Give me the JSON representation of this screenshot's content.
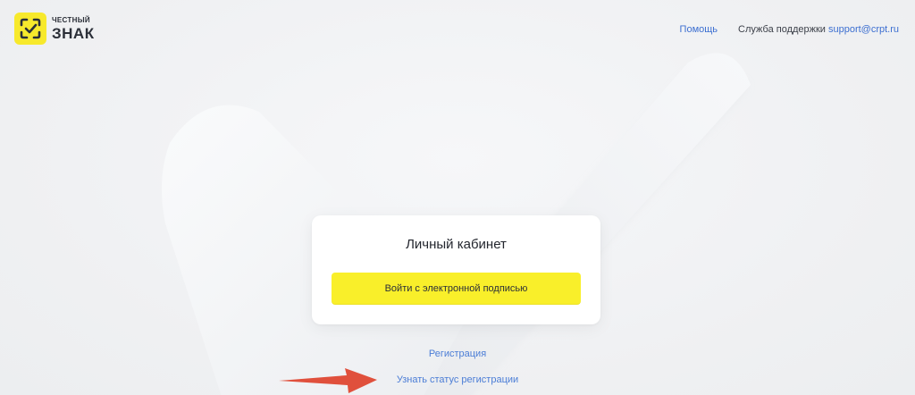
{
  "header": {
    "logo": {
      "line1": "ЧЕСТНЫЙ",
      "line2": "ЗНАК",
      "icon": "check-frame-icon"
    },
    "nav": {
      "help_label": "Помощь",
      "support_label": "Служба поддержки",
      "support_email": "support@crpt.ru"
    }
  },
  "login_card": {
    "title": "Личный кабинет",
    "sign_button_label": "Войти с электронной подписью"
  },
  "links": {
    "register": "Регистрация",
    "registration_status": "Узнать статус регистрации"
  },
  "annotation": {
    "icon": "red-arrow-icon"
  },
  "colors": {
    "brand_yellow": "#f9ef2a",
    "link_blue": "#3c6fd1",
    "annotation_red": "#e0503c"
  }
}
